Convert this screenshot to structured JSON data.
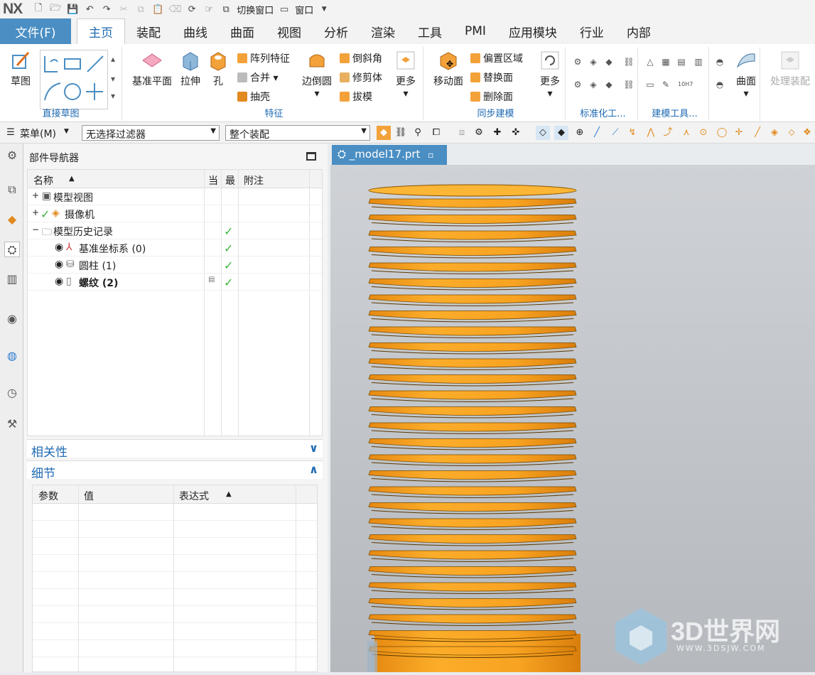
{
  "app": {
    "logo": "NX"
  },
  "quick_access": {
    "switch_window": "切换窗口",
    "window": "窗口"
  },
  "tabs": [
    "文件(F)",
    "主页",
    "装配",
    "曲线",
    "曲面",
    "视图",
    "分析",
    "渲染",
    "工具",
    "PMI",
    "应用模块",
    "行业",
    "内部"
  ],
  "ribbon": {
    "direct_sketch": {
      "sketch": "草图",
      "label": "直接草图"
    },
    "feature": {
      "datum_plane": "基准平面",
      "extrude": "拉伸",
      "hole": "孔",
      "pattern": "阵列特征",
      "unite": "合并",
      "shell": "抽壳",
      "edge_blend": "边倒圆",
      "chamfer": "倒斜角",
      "trim_body": "修剪体",
      "draft": "拔模",
      "more": "更多",
      "label": "特征"
    },
    "sync": {
      "move_face": "移动面",
      "offset_region": "偏置区域",
      "replace_face": "替换面",
      "delete_face": "删除面",
      "more": "更多",
      "label": "同步建模"
    },
    "standard": {
      "label": "标准化工..."
    },
    "modeling_tools": {
      "label": "建模工具..."
    },
    "surface": {
      "label": "曲面"
    },
    "process_assembly": {
      "label": "处理装配"
    }
  },
  "selection_bar": {
    "menu": "菜单(M)",
    "filter": "无选择过滤器",
    "scope": "整个装配"
  },
  "navigator": {
    "title": "部件导航器",
    "columns": {
      "name": "名称",
      "current": "当",
      "latest": "最",
      "note": "附注"
    },
    "rows": [
      {
        "label": "模型视图",
        "check": ""
      },
      {
        "label": "摄像机",
        "check": ""
      },
      {
        "label": "模型历史记录",
        "check": "✓"
      },
      {
        "label": "基准坐标系 (0)",
        "check": "✓"
      },
      {
        "label": "圆柱 (1)",
        "check": "✓"
      },
      {
        "label": "螺纹 (2)",
        "check": "✓"
      }
    ],
    "dependency": "相关性",
    "details": "细节",
    "detail_columns": {
      "param": "参数",
      "value": "值",
      "expr": "表达式"
    }
  },
  "graphics": {
    "tab": "_model17.prt",
    "watermark": "3D世界网",
    "watermark_url": "WWW.3DSJW.COM"
  },
  "colors": {
    "accent": "#4a8ec3",
    "part": "#f7a51c"
  }
}
